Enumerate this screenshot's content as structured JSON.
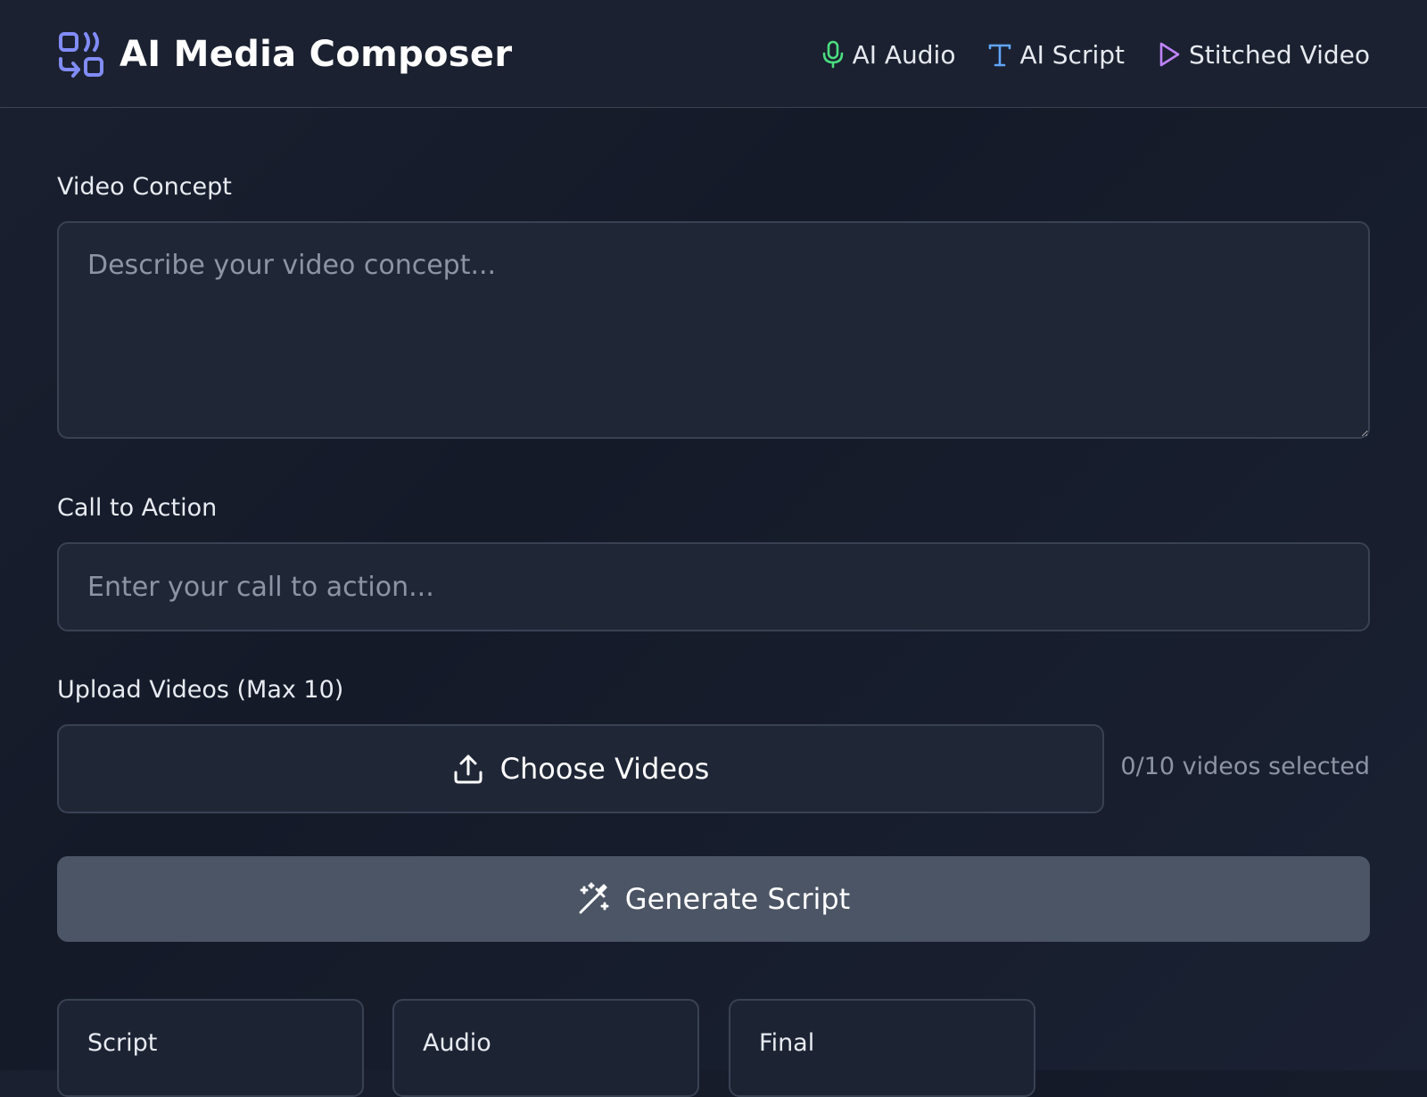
{
  "header": {
    "title": "AI Media Composer",
    "logo_icon": "repeat-arrows-icon",
    "nav": [
      {
        "label": "AI Audio",
        "icon": "microphone-icon",
        "color": "#4ade80"
      },
      {
        "label": "AI Script",
        "icon": "type-icon",
        "color": "#60a5fa"
      },
      {
        "label": "Stitched Video",
        "icon": "play-icon",
        "color": "#c084fc"
      }
    ],
    "accent": "#818cf8"
  },
  "form": {
    "concept_label": "Video Concept",
    "concept_placeholder": "Describe your video concept...",
    "concept_value": "",
    "cta_label": "Call to Action",
    "cta_placeholder": "Enter your call to action...",
    "cta_value": "",
    "upload_label": "Upload Videos (Max 10)",
    "choose_label": "Choose Videos",
    "selected_count": "0/10 videos selected",
    "generate_label": "Generate Script"
  },
  "cards": [
    {
      "title": "Script"
    },
    {
      "title": "Audio"
    },
    {
      "title": "Final"
    }
  ]
}
